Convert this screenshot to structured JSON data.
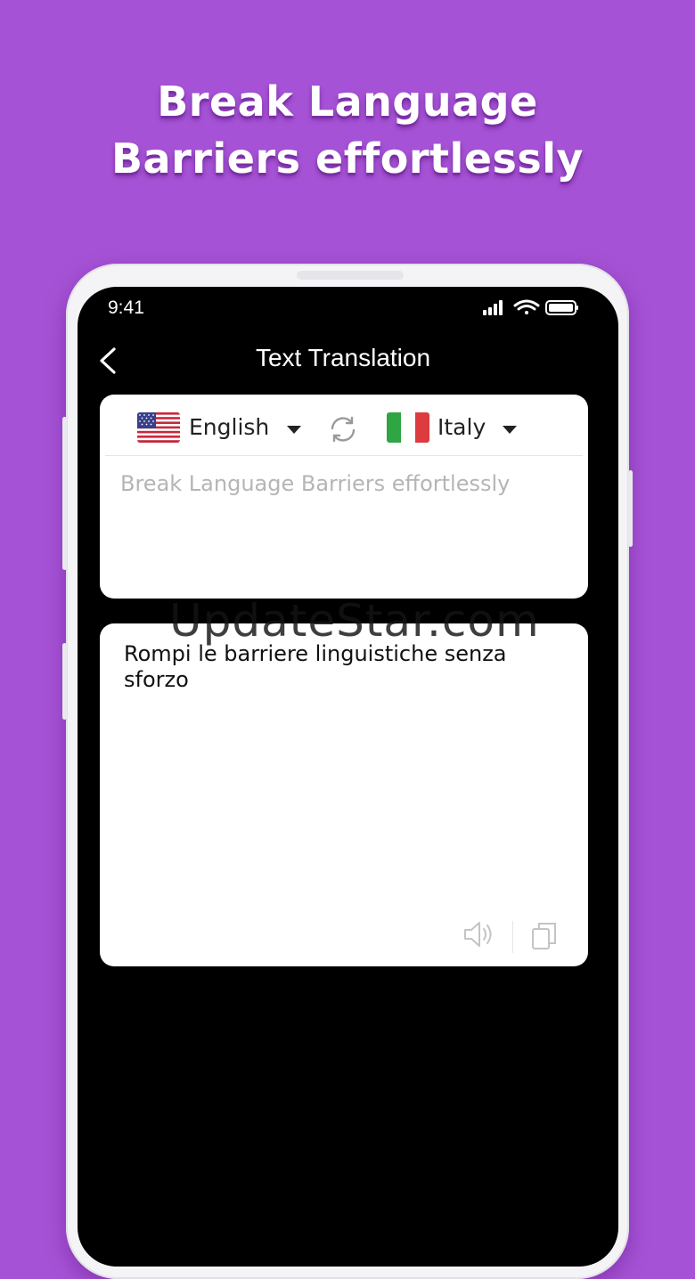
{
  "headline": {
    "line1": "Break Language",
    "line2": "Barriers effortlessly"
  },
  "status_bar": {
    "time": "9:41",
    "icons": [
      "signal-icon",
      "wifi-icon",
      "battery-icon"
    ]
  },
  "header": {
    "title": "Text Translation",
    "back_icon": "chevron-left-icon"
  },
  "languages": {
    "source": {
      "label": "English",
      "flag": "us-flag-icon"
    },
    "target": {
      "label": "Italy",
      "flag": "italy-flag-icon"
    },
    "swap_icon": "swap-icon"
  },
  "source_input": {
    "placeholder": "Break Language Barriers effortlessly"
  },
  "translation": {
    "text": "Rompi le barriere linguistiche senza sforzo",
    "actions": [
      "speaker-icon",
      "copy-icon"
    ]
  },
  "watermark": "UpdateStar.com",
  "colors": {
    "background": "#a652d6",
    "screen": "#000000",
    "card": "#ffffff",
    "placeholder": "#b5b5b5"
  }
}
